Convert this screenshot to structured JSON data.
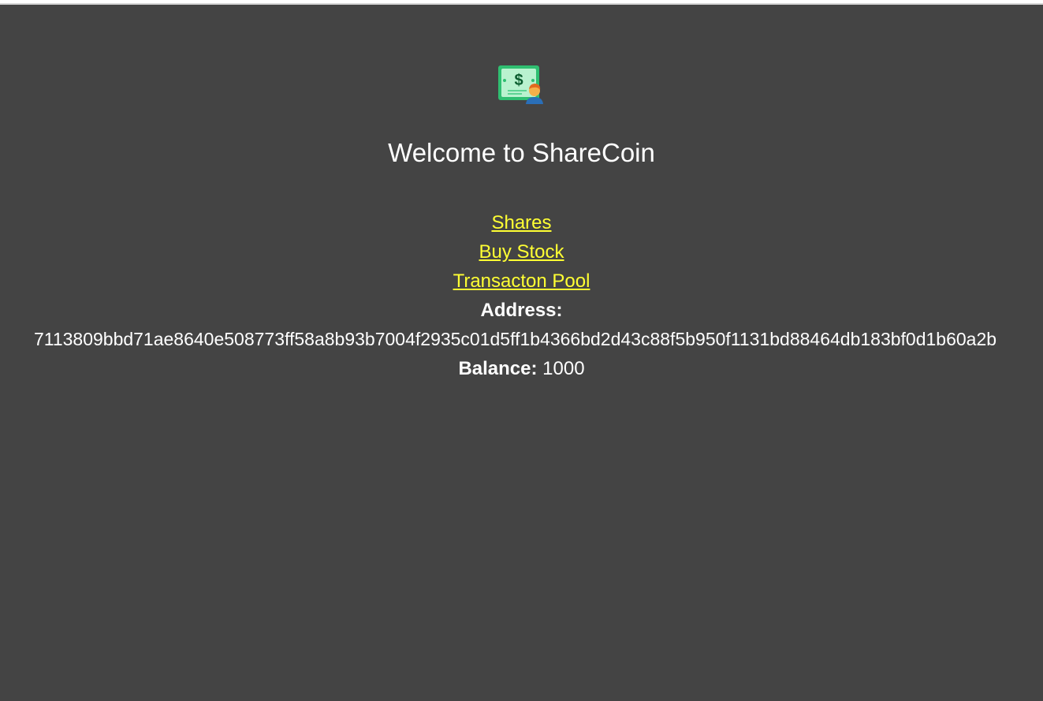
{
  "header": {
    "logo_icon": "money-bill-person-icon",
    "title": "Welcome to ShareCoin"
  },
  "nav": {
    "items": [
      {
        "label": "Shares"
      },
      {
        "label": "Buy Stock"
      },
      {
        "label": "Transacton Pool"
      }
    ]
  },
  "account": {
    "address_label": "Address:",
    "address": "7113809bbd71ae8640e508773ff58a8b93b7004f2935c01d5ff1b4366bd2d43c88f5b950f1131bd88464db183bf0d1b60a2b",
    "balance_label": "Balance:",
    "balance": "1000"
  },
  "colors": {
    "background": "#444444",
    "link": "#ffff33",
    "text": "#ffffff"
  }
}
